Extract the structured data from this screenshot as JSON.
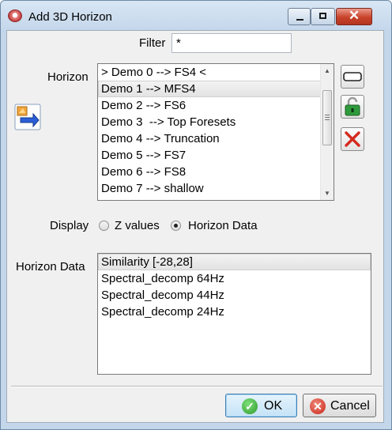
{
  "window": {
    "title": "Add 3D Horizon"
  },
  "filter": {
    "label": "Filter",
    "value": "*"
  },
  "horizon": {
    "label": "Horizon",
    "items": [
      "> Demo 0 --> FS4 <",
      "Demo 1 --> MFS4",
      "Demo 2 --> FS6",
      "Demo 3  --> Top Foresets",
      "Demo 4 --> Truncation",
      "Demo 5 --> FS7",
      "Demo 6 --> FS8",
      "Demo 7 --> shallow"
    ],
    "selected_index": 1
  },
  "display": {
    "label": "Display",
    "options": [
      "Z values",
      "Horizon Data"
    ],
    "selected": "Horizon Data"
  },
  "horizon_data": {
    "label": "Horizon Data",
    "items": [
      "Similarity [-28,28]",
      "Spectral_decomp 64Hz",
      "Spectral_decomp 44Hz",
      "Spectral_decomp 24Hz"
    ],
    "selected_index": 0
  },
  "buttons": {
    "ok": "OK",
    "cancel": "Cancel"
  },
  "icons": {
    "title": "app-logo-icon",
    "transfer": "import-arrow-icon",
    "rename": "rename-icon",
    "lock": "unlock-icon",
    "remove": "red-x-icon",
    "ok": "green-check-icon",
    "cancel": "red-x-circle-icon"
  }
}
